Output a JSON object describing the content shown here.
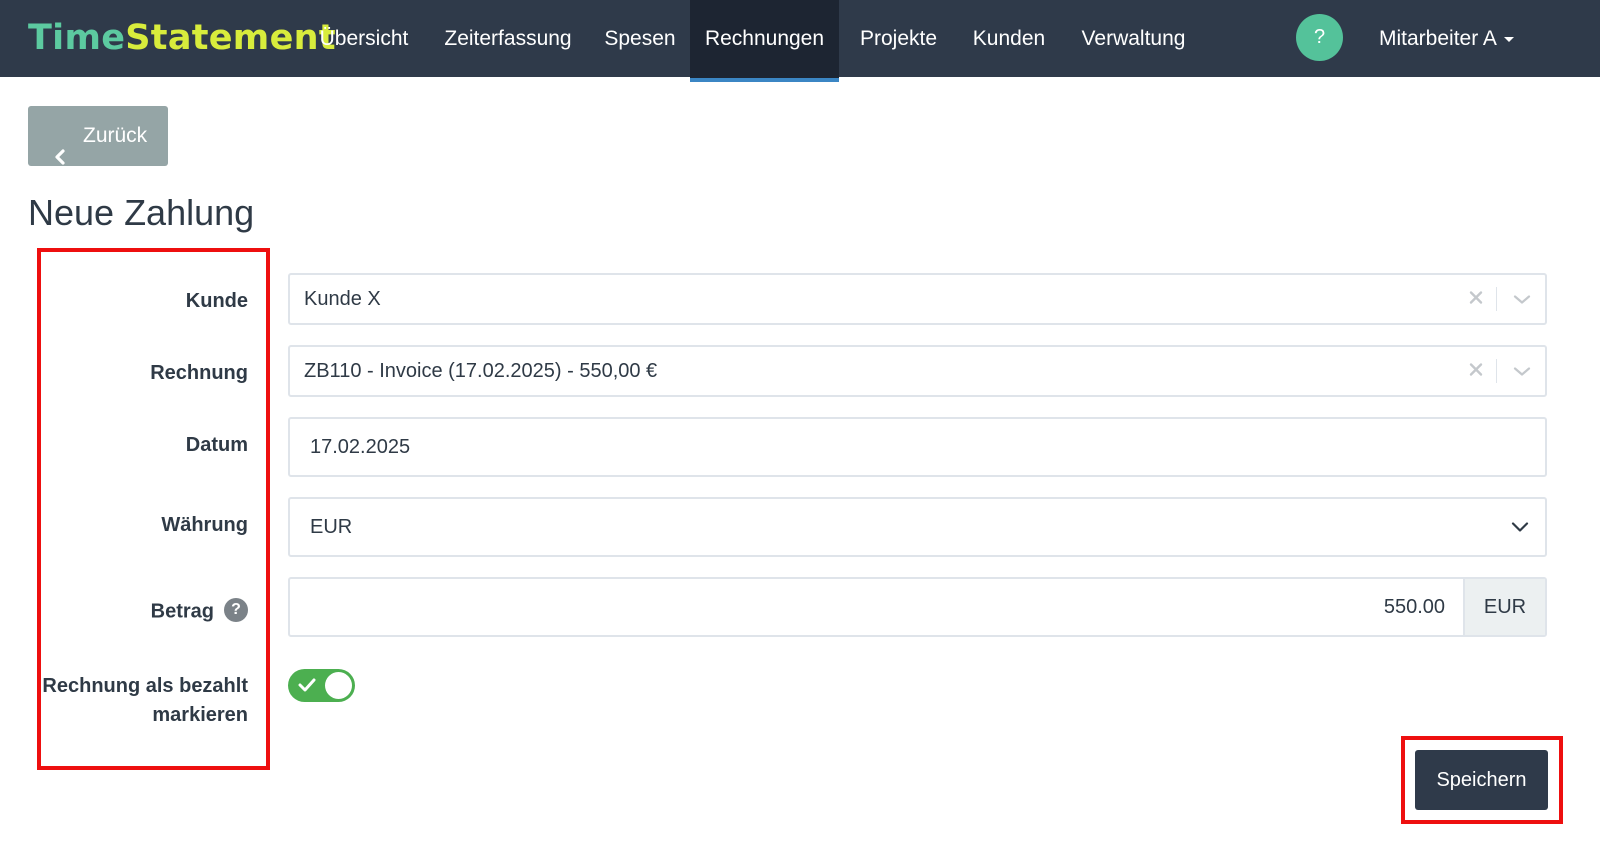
{
  "brand": {
    "part1": "Time",
    "part2": "Statement"
  },
  "nav": {
    "items": [
      {
        "label": "Übersicht"
      },
      {
        "label": "Zeiterfassung"
      },
      {
        "label": "Spesen"
      },
      {
        "label": "Rechnungen",
        "active": true
      },
      {
        "label": "Projekte"
      },
      {
        "label": "Kunden"
      },
      {
        "label": "Verwaltung"
      }
    ],
    "help_label": "?",
    "user": "Mitarbeiter A"
  },
  "back_button": {
    "label": "Zurück",
    "icon": "chevron-left-icon"
  },
  "page_title": "Neue Zahlung",
  "form": {
    "kunde": {
      "label": "Kunde",
      "value": "Kunde X"
    },
    "rechnung": {
      "label": "Rechnung",
      "value": "ZB110 - Invoice (17.02.2025) - 550,00 €"
    },
    "datum": {
      "label": "Datum",
      "value": "17.02.2025"
    },
    "waehrung": {
      "label": "Währung",
      "value": "EUR"
    },
    "betrag": {
      "label": "Betrag",
      "help": "?",
      "value": "550.00",
      "unit": "EUR"
    },
    "paid_toggle": {
      "label_line1": "Rechnung als bezahlt",
      "label_line2": "markieren",
      "checked": true
    }
  },
  "save_button": {
    "label": "Speichern"
  },
  "colors": {
    "navbar": "#2f3a4a",
    "active_tab": "#1d2532",
    "active_indicator": "#3b86c4",
    "logo_time": "#5ccaa0",
    "logo_statement": "#d8ec3c",
    "help_circle": "#54c29a",
    "toggle_on": "#4caf50",
    "annotation_red": "#ee0f0f"
  }
}
